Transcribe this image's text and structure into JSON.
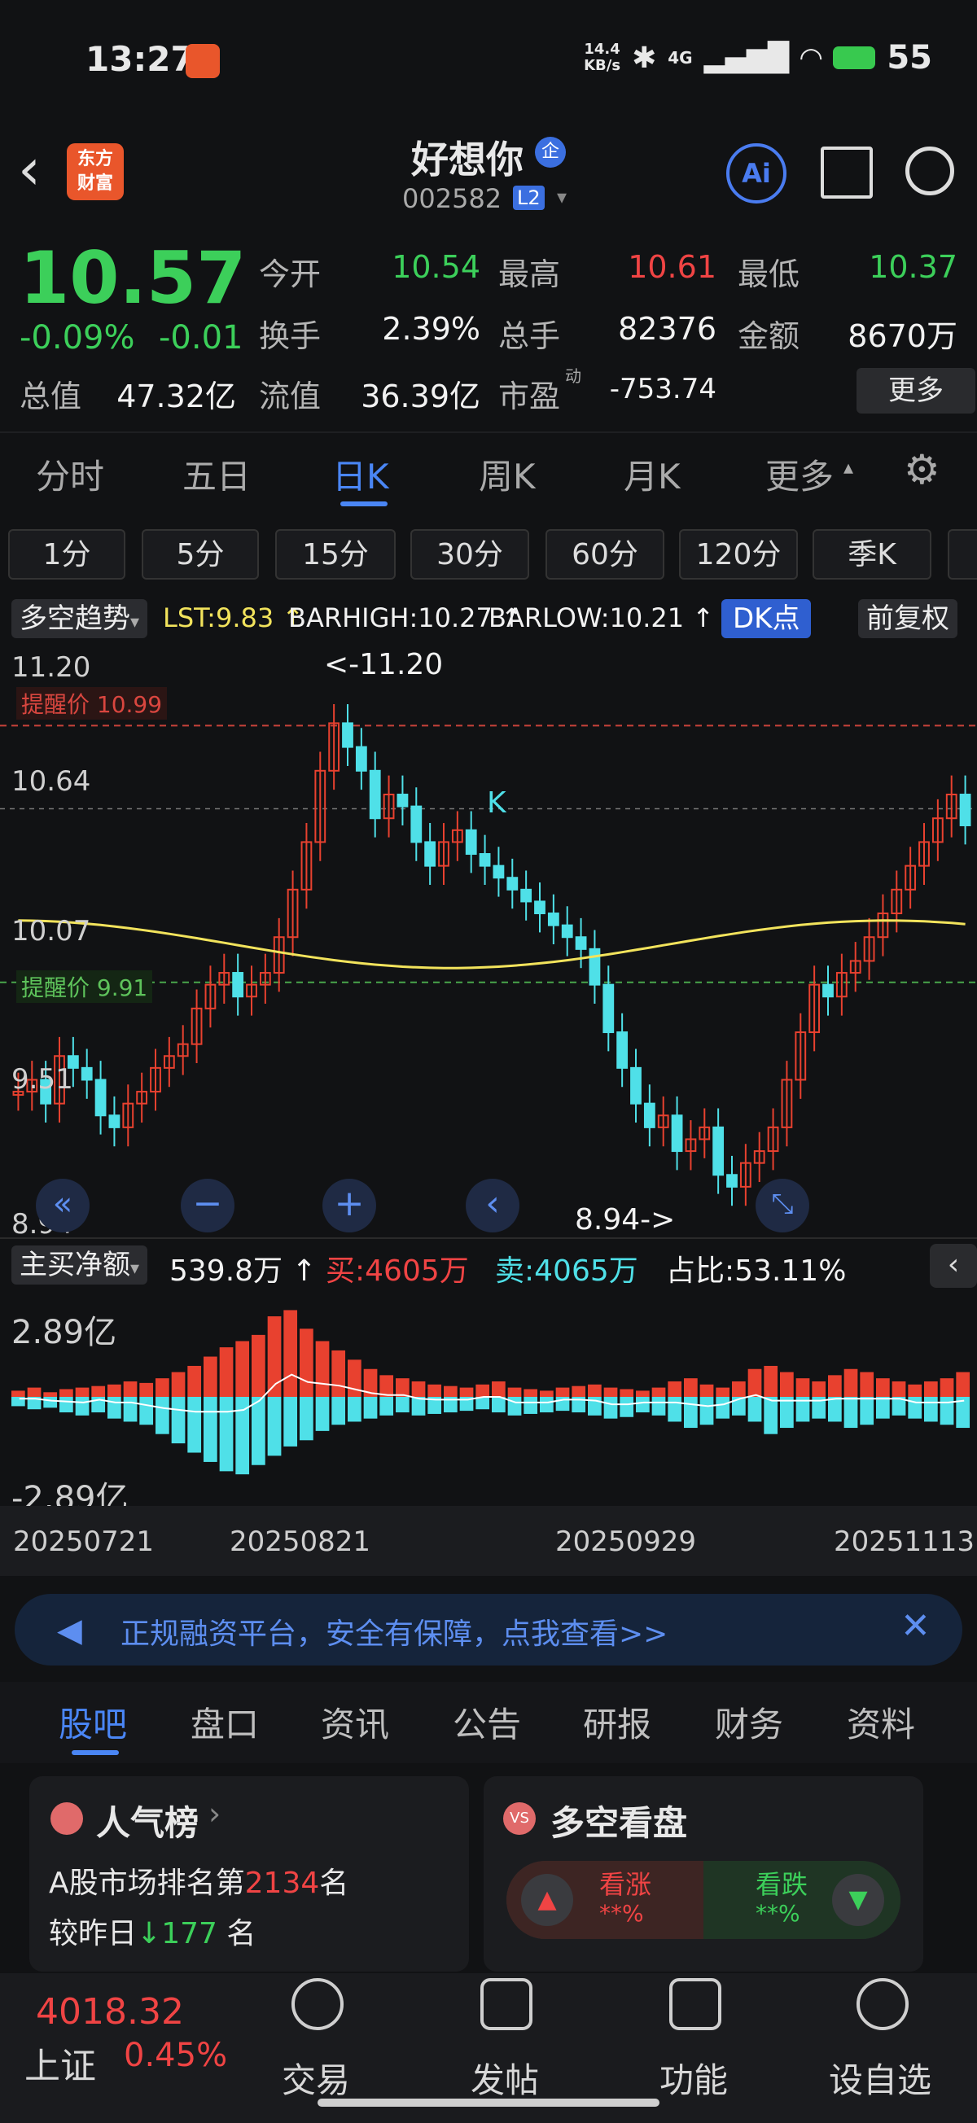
{
  "status_bar": {
    "time": "13:27",
    "net_speed_top": "14.4",
    "net_speed_bottom": "KB/s",
    "network": "4G",
    "battery": "55"
  },
  "header": {
    "stock_name": "好想你",
    "name_badge": "企",
    "stock_code": "002582",
    "level_badge": "L2",
    "logo_line1": "东方",
    "logo_line2": "财富",
    "ai_label": "Ai"
  },
  "quote": {
    "price": "10.57",
    "change_pct": "-0.09%",
    "change": "-0.01",
    "open_label": "今开",
    "open": "10.54",
    "high_label": "最高",
    "high": "10.61",
    "low_label": "最低",
    "low": "10.37",
    "turnover_label": "换手",
    "turnover": "2.39%",
    "volume_label": "总手",
    "volume": "82376",
    "amount_label": "金额",
    "amount": "8670万",
    "mktcap_label": "总值",
    "mktcap": "47.32亿",
    "float_label": "流值",
    "float": "36.39亿",
    "pe_label": "市盈",
    "pe_sup": "动",
    "pe": "-753.74",
    "more_label": "更多"
  },
  "tabs": [
    "分时",
    "五日",
    "日K",
    "周K",
    "月K",
    "更多"
  ],
  "periods": [
    "1分",
    "5分",
    "15分",
    "30分",
    "60分",
    "120分",
    "季K"
  ],
  "indicator": {
    "name": "多空趋势",
    "lst": "LST:9.83",
    "barhigh": "BARHIGH:10.27",
    "barlow": "BARLOW:10.21",
    "dk_label": "DK点",
    "adjust_label": "前复权"
  },
  "chart": {
    "y_labels": [
      "11.20",
      "10.64",
      "10.07",
      "9.51",
      "8.94"
    ],
    "alert_high": "提醒价 10.99",
    "alert_low": "提醒价 9.91",
    "max_marker": "<-11.20",
    "min_marker": "8.94->",
    "k_label": "K",
    "colors": {
      "up": "#e8412f",
      "down": "#4fe0e8",
      "green": "#6ecb3c",
      "ma": "#f2e35c",
      "alert_red": "#c8423a",
      "alert_green": "#49a64b"
    }
  },
  "chart_data": [
    {
      "type": "candlestick",
      "ylim": [
        8.94,
        11.2
      ],
      "y_ticks": [
        11.2,
        10.64,
        10.07,
        9.51,
        8.94
      ],
      "x_labels": [
        "20250721",
        "20250821",
        "20250929",
        "20251113"
      ],
      "close_series": [
        9.45,
        9.5,
        9.4,
        9.6,
        9.55,
        9.5,
        9.35,
        9.3,
        9.4,
        9.45,
        9.55,
        9.6,
        9.65,
        9.8,
        9.9,
        9.95,
        9.85,
        9.9,
        9.95,
        10.1,
        10.3,
        10.5,
        10.8,
        11.0,
        10.9,
        10.8,
        10.6,
        10.7,
        10.65,
        10.5,
        10.4,
        10.5,
        10.55,
        10.45,
        10.4,
        10.35,
        10.3,
        10.25,
        10.2,
        10.15,
        10.1,
        10.05,
        9.9,
        9.7,
        9.55,
        9.4,
        9.3,
        9.35,
        9.2,
        9.25,
        9.3,
        9.1,
        9.05,
        9.15,
        9.2,
        9.3,
        9.5,
        9.7,
        9.9,
        9.85,
        9.95,
        10.0,
        10.1,
        10.2,
        10.3,
        10.4,
        10.5,
        10.6,
        10.7,
        10.57
      ],
      "ma_label": "",
      "alert_prices": [
        10.99,
        9.91
      ]
    },
    {
      "type": "bar",
      "title": "主买净额",
      "values_label": "539.8万",
      "buy": "买:4605万",
      "sell": "卖:4065万",
      "ratio": "占比:53.11%",
      "ylim_labels": [
        "2.89亿",
        "-2.89亿"
      ],
      "values": [
        0.2,
        0.3,
        0.15,
        0.25,
        0.3,
        0.35,
        0.4,
        0.5,
        0.45,
        0.6,
        0.8,
        1.0,
        1.3,
        1.6,
        1.8,
        2.0,
        2.6,
        2.8,
        2.2,
        1.8,
        1.5,
        1.2,
        0.9,
        0.7,
        0.6,
        0.5,
        0.4,
        0.35,
        0.3,
        0.4,
        0.5,
        0.3,
        0.25,
        0.2,
        0.3,
        0.35,
        0.4,
        0.3,
        0.25,
        0.2,
        0.3,
        0.5,
        0.6,
        0.4,
        0.3,
        0.5,
        0.9,
        1.0,
        0.8,
        0.6,
        0.5,
        0.7,
        0.9,
        0.8,
        0.6,
        0.5,
        0.4,
        0.5,
        0.6,
        0.8
      ],
      "neg_values": [
        -0.3,
        -0.4,
        -0.35,
        -0.5,
        -0.6,
        -0.5,
        -0.7,
        -0.8,
        -0.9,
        -1.2,
        -1.5,
        -1.8,
        -2.1,
        -2.4,
        -2.5,
        -2.2,
        -1.9,
        -1.6,
        -1.4,
        -1.1,
        -0.9,
        -0.8,
        -0.7,
        -0.6,
        -0.5,
        -0.6,
        -0.55,
        -0.5,
        -0.45,
        -0.4,
        -0.5,
        -0.6,
        -0.55,
        -0.5,
        -0.45,
        -0.5,
        -0.6,
        -0.7,
        -0.65,
        -0.5,
        -0.6,
        -0.8,
        -1.0,
        -0.9,
        -0.7,
        -0.6,
        -0.8,
        -1.2,
        -1.0,
        -0.8,
        -0.7,
        -0.8,
        -1.0,
        -0.9,
        -0.7,
        -0.6,
        -0.7,
        -0.8,
        -0.9,
        -1.0
      ]
    }
  ],
  "banner": {
    "text": "正规融资平台，安全有保障，点我查看>>"
  },
  "bottom_tabs": [
    "股吧",
    "盘口",
    "资讯",
    "公告",
    "研报",
    "财务",
    "资料"
  ],
  "popularity": {
    "title": "人气榜",
    "rank_prefix": "A股市场排名第",
    "rank": "2134",
    "rank_suffix": "名",
    "change_prefix": "较昨日",
    "change": "177",
    "change_suffix": "名"
  },
  "sentiment": {
    "title": "多空看盘",
    "bull_label": "看涨",
    "bull_value": "**%",
    "bear_label": "看跌",
    "bear_value": "**%"
  },
  "bottom_nav": {
    "index_value": "4018.32",
    "index_name": "上证",
    "index_change": "0.45%",
    "items": [
      "交易",
      "发帖",
      "功能",
      "设自选"
    ]
  }
}
